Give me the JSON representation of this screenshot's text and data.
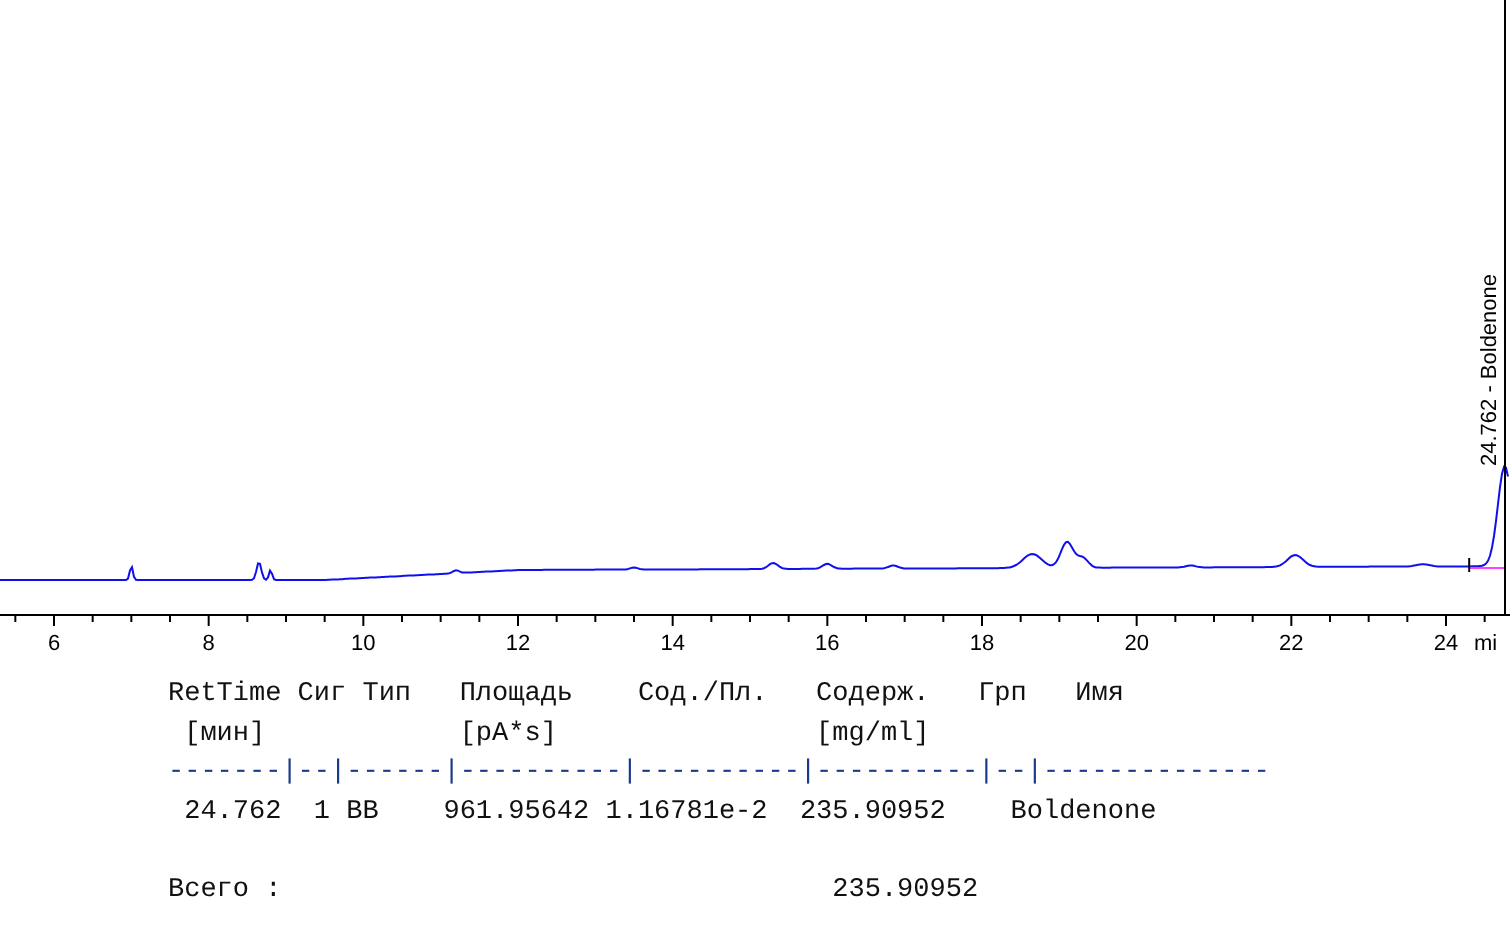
{
  "chromatogram": {
    "x_axis": {
      "ticks": [
        "6",
        "8",
        "10",
        "12",
        "14",
        "16",
        "18",
        "20",
        "22",
        "24"
      ],
      "unit": "mi"
    },
    "peak_label": "24.762 - Boldenone"
  },
  "report": {
    "header_line": "RetTime Сиг Тип   Площадь    Сод./Пл.   Содерж.   Грп   Имя",
    "units_line": " [мин]            [pA*s]                [mg/ml]",
    "separator_line": "-------|--|------|----------|----------|----------|--|--------------",
    "rows": [
      " 24.762  1 BB    961.95642 1.16781e-2  235.90952    Boldenone"
    ],
    "total_line": "Всего :                                  235.90952"
  }
}
